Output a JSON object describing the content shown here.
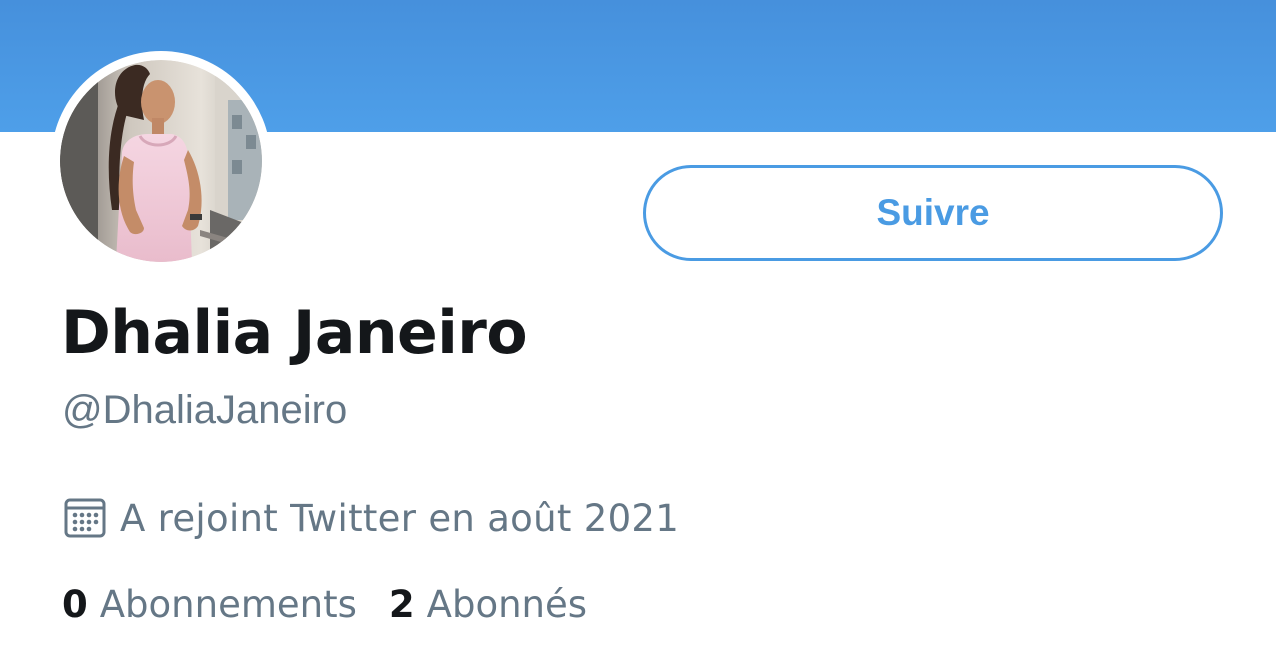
{
  "colors": {
    "banner_top": "#4690dc",
    "banner_bottom": "#4e9fe9",
    "accent": "#4a9be3",
    "text_primary": "#14171a",
    "text_secondary": "#657786"
  },
  "profile": {
    "display_name": "Dhalia Janeiro",
    "handle": "@DhaliaJaneiro",
    "avatar_icon": "profile-photo"
  },
  "actions": {
    "follow_label": "Suivre"
  },
  "meta": {
    "joined_icon": "calendar-icon",
    "joined_text": "A rejoint Twitter en août 2021"
  },
  "stats": {
    "following_count": "0",
    "following_label": "Abonnements",
    "followers_count": "2",
    "followers_label": "Abonnés"
  }
}
